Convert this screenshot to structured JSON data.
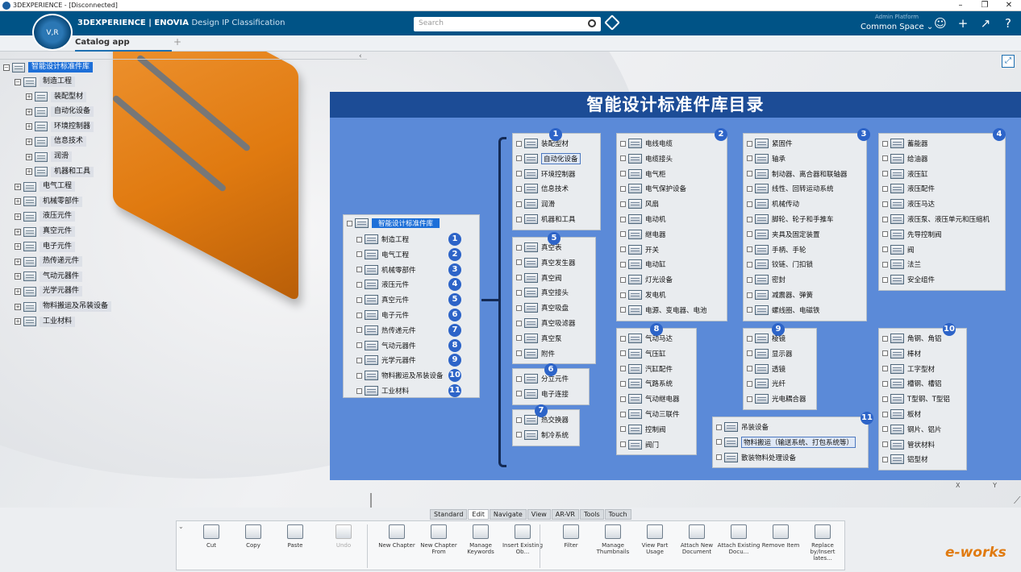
{
  "window": {
    "title": "3DEXPERIENCE - [Disconnected]"
  },
  "topbar": {
    "brand_main": "3DEXPERIENCE | ENOVIA",
    "brand_app": "Design IP Classification",
    "search_placeholder": "Search",
    "platform": "Admin Platform",
    "space": "Common Space ⌄",
    "compass_label": "V,R"
  },
  "tabs": {
    "active": "Catalog app",
    "add": "+"
  },
  "tree": {
    "root": "智能设计标准件库",
    "items": [
      {
        "label": "制造工程",
        "level": 1,
        "expanded": true
      },
      {
        "label": "装配型材",
        "level": 2
      },
      {
        "label": "自动化设备",
        "level": 2
      },
      {
        "label": "环境控制器",
        "level": 2
      },
      {
        "label": "信息技术",
        "level": 2
      },
      {
        "label": "润滑",
        "level": 2
      },
      {
        "label": "机器和工具",
        "level": 2
      },
      {
        "label": "电气工程",
        "level": 1
      },
      {
        "label": "机械零部件",
        "level": 1
      },
      {
        "label": "液压元件",
        "level": 1
      },
      {
        "label": "真空元件",
        "level": 1
      },
      {
        "label": "电子元件",
        "level": 1
      },
      {
        "label": "热传递元件",
        "level": 1
      },
      {
        "label": "气动元器件",
        "level": 1
      },
      {
        "label": "光学元器件",
        "level": 1
      },
      {
        "label": "物料搬运及吊装设备",
        "level": 1
      },
      {
        "label": "工业材料",
        "level": 1
      }
    ]
  },
  "banner": {
    "title": "智能设计标准件库目录",
    "left_panel": {
      "root": "智能设计标准件库",
      "items": [
        "制造工程",
        "电气工程",
        "机械零部件",
        "液压元件",
        "真空元件",
        "电子元件",
        "热传递元件",
        "气动元器件",
        "光学元器件",
        "物料搬运及吊装设备",
        "工业材料"
      ],
      "numbers": [
        "1",
        "2",
        "3",
        "4",
        "5",
        "6",
        "7",
        "8",
        "9",
        "10",
        "11"
      ]
    },
    "panels": [
      {
        "num": "1",
        "items": [
          "装配型材",
          "自动化设备",
          "环境控制器",
          "信息技术",
          "润滑",
          "机器和工具"
        ]
      },
      {
        "num": "2",
        "items": [
          "电线电缆",
          "电缆接头",
          "电气柜",
          "电气保护设备",
          "风扇",
          "电动机",
          "继电器",
          "开关",
          "电动缸",
          "灯光设备",
          "发电机",
          "电源、变电器、电池"
        ]
      },
      {
        "num": "3",
        "items": [
          "紧固件",
          "轴承",
          "制动器、离合器和联轴器",
          "线性、回转运动系统",
          "机械传动",
          "脚轮、轮子和手推车",
          "夹具及固定装置",
          "手柄、手轮",
          "铰链、门扣锁",
          "密封",
          "减震器、弹簧",
          "螺线圈、电磁铁"
        ]
      },
      {
        "num": "4",
        "items": [
          "蓄能器",
          "给油器",
          "液压缸",
          "液压配件",
          "液压马达",
          "液压泵、液压单元和压缩机",
          "先导控制阀",
          "阀",
          "法兰",
          "安全组件"
        ]
      },
      {
        "num": "5",
        "items": [
          "真空表",
          "真空发生器",
          "真空阀",
          "真空接头",
          "真空吸盘",
          "真空吸滤器",
          "真空泵",
          "附件"
        ]
      },
      {
        "num": "6",
        "items": [
          "分立元件",
          "电子连接"
        ]
      },
      {
        "num": "7",
        "items": [
          "热交换器",
          "制冷系统"
        ]
      },
      {
        "num": "8",
        "items": [
          "气动马达",
          "气压缸",
          "汽缸配件",
          "气路系统",
          "气动继电器",
          "气动三联件",
          "控制阀",
          "阀门"
        ]
      },
      {
        "num": "9",
        "items": [
          "棱镜",
          "显示器",
          "透镜",
          "光纤",
          "光电耦合器"
        ]
      },
      {
        "num": "10",
        "items": [
          "角钢、角铝",
          "棒材",
          "工字型材",
          "槽钢、槽铝",
          "T型钢、T型铝",
          "板材",
          "钢片、铝片",
          "管状材料",
          "铝型材"
        ]
      },
      {
        "num": "11",
        "items": [
          "吊装设备",
          "物料搬运（输送系统、打包系统等）",
          "散装物料处理设备"
        ]
      }
    ]
  },
  "axes": {
    "x": "X",
    "y": "Y"
  },
  "toolbar": {
    "tabs": [
      "Standard",
      "Edit",
      "Navigate",
      "View",
      "AR-VR",
      "Tools",
      "Touch"
    ],
    "tools": [
      "Cut",
      "Copy",
      "Paste",
      "Undo",
      "New Chapter",
      "New Chapter From",
      "Manage Keywords",
      "Insert Existing Ob...",
      "Filter",
      "Manage Thumbnails",
      "View Part Usage",
      "Attach New Document",
      "Attach Existing Docu...",
      "Remove Item",
      "Replace by/Insert lates..."
    ]
  },
  "watermark": "e-works"
}
